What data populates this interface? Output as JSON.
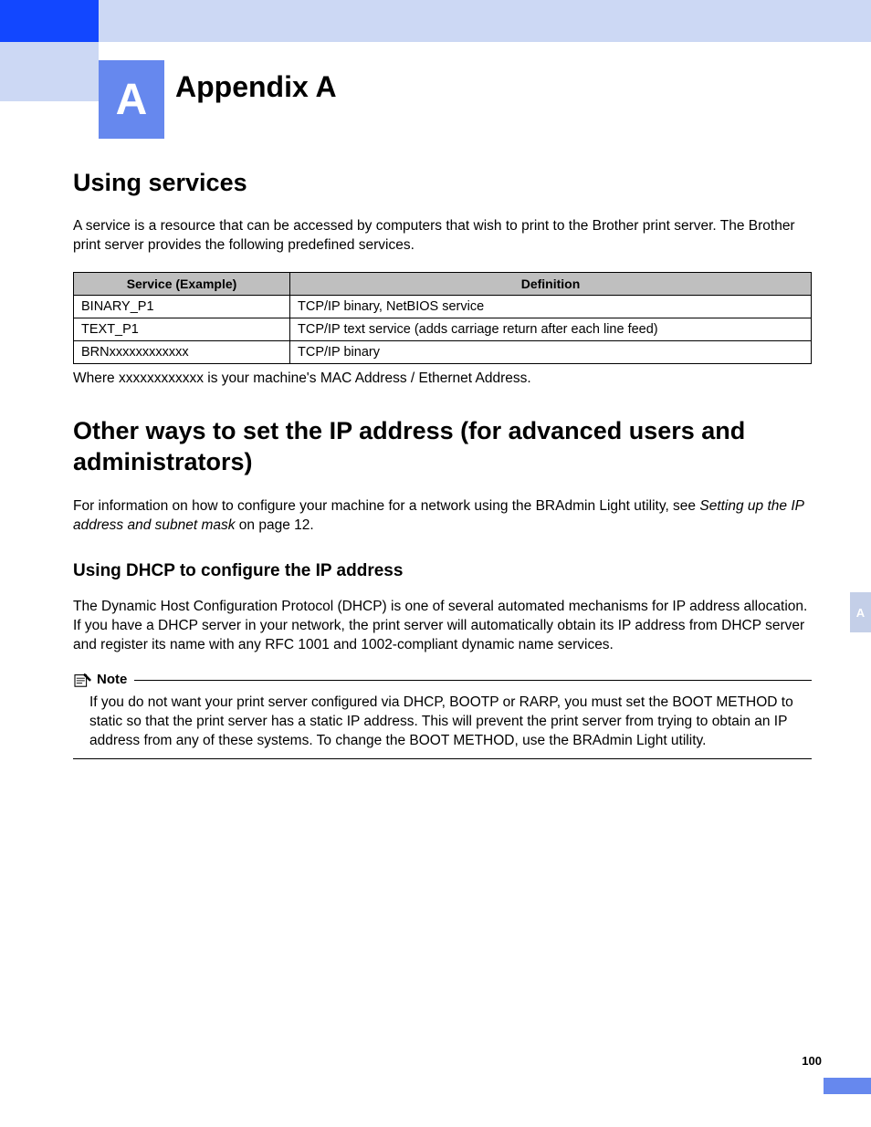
{
  "header": {
    "badge": "A",
    "title": "Appendix A"
  },
  "sections": {
    "using_services": {
      "title": "Using services",
      "intro": "A service is a resource that can be accessed by computers that wish to print to the Brother print server. The Brother print server provides the following predefined services.",
      "table": {
        "headers": [
          "Service (Example)",
          "Definition"
        ],
        "rows": [
          [
            "BINARY_P1",
            "TCP/IP binary, NetBIOS service"
          ],
          [
            "TEXT_P1",
            "TCP/IP text service (adds carriage return after each line feed)"
          ],
          [
            "BRNxxxxxxxxxxxx",
            "TCP/IP binary"
          ]
        ]
      },
      "footnote": "Where xxxxxxxxxxxx is your machine's MAC Address / Ethernet Address."
    },
    "other_ways": {
      "title": "Other ways to set the IP address (for advanced users and administrators)",
      "intro_pre": "For information on how to configure your machine for a network using the BRAdmin Light utility, see ",
      "intro_ital": "Setting up the IP address and subnet mask",
      "intro_post": " on page 12."
    },
    "dhcp": {
      "title": "Using DHCP to configure the IP address",
      "body": "The Dynamic Host Configuration Protocol (DHCP) is one of several automated mechanisms for IP address allocation. If you have a DHCP server in your network, the print server will automatically obtain its IP address from DHCP server and register its name with any RFC 1001 and 1002-compliant dynamic name services.",
      "note_label": "Note",
      "note_body": "If you do not want your print server configured via DHCP, BOOTP or RARP, you must set the BOOT METHOD to static so that the print server has a static IP address. This will prevent the print server from trying to obtain an IP address from any of these systems. To change the BOOT METHOD, use the BRAdmin Light utility."
    }
  },
  "side_tab": "A",
  "page_number": "100"
}
